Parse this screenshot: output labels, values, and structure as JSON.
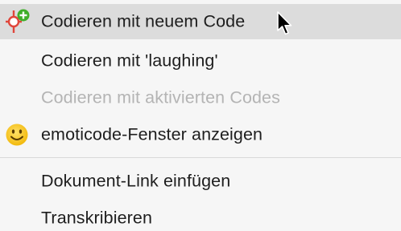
{
  "context_menu": {
    "items": [
      {
        "label": "Codieren mit neuem Code",
        "icon": "new-code-icon",
        "highlighted": true,
        "enabled": true
      },
      {
        "label": "Codieren mit 'laughing'",
        "icon": "",
        "highlighted": false,
        "enabled": true
      },
      {
        "label": "Codieren mit aktivierten Codes",
        "icon": "",
        "highlighted": false,
        "enabled": false
      },
      {
        "label": "emoticode-Fenster anzeigen",
        "icon": "smiley-icon",
        "highlighted": false,
        "enabled": true
      },
      {
        "label": "Dokument-Link einfügen",
        "icon": "",
        "highlighted": false,
        "enabled": true
      },
      {
        "label": "Transkribieren",
        "icon": "",
        "highlighted": false,
        "enabled": true
      }
    ]
  },
  "colors": {
    "highlight": "#dcdcdc",
    "text": "#1e1e1e",
    "disabled_text": "#b4b4b4",
    "code_icon_red": "#e0463b",
    "code_icon_green": "#3fae2a",
    "smiley_yellow": "#f5c518"
  }
}
